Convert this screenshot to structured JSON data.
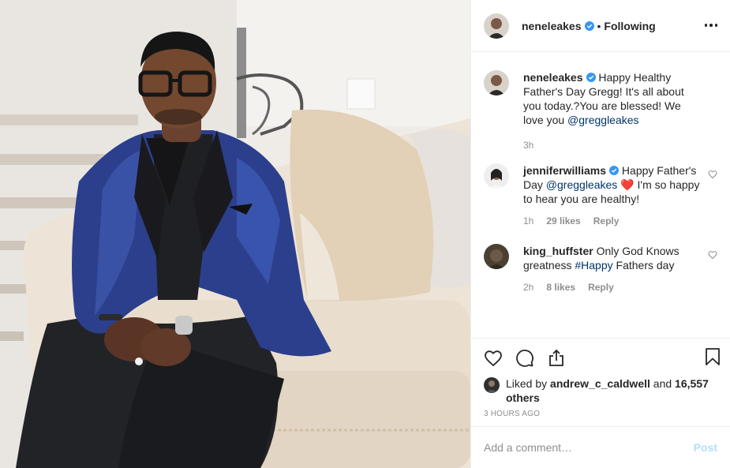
{
  "post": {
    "owner": "neneleakes",
    "dot": "•",
    "follow_status": "Following"
  },
  "caption": {
    "username": "neneleakes",
    "text": " Happy Healthy Father's Day Gregg! It's all about you today.?You are blessed! We love you ",
    "mention": "@greggleakes",
    "time": "3h"
  },
  "comments": [
    {
      "username": "jenniferwilliams",
      "text_before": " Happy Father's Day ",
      "mention": "@greggleakes",
      "emoji": "❤️",
      "text_after": " I'm so happy to hear you are healthy!",
      "time": "1h",
      "likes": "29 likes",
      "reply": "Reply"
    },
    {
      "username": "king_huffster",
      "text_before": " Only God Knows greatness ",
      "hashtag": "#Happy",
      "text_after": " Fathers day",
      "time": "2h",
      "likes": "8 likes",
      "reply": "Reply"
    }
  ],
  "likes": {
    "prefix": "Liked by ",
    "user": "andrew_c_caldwell",
    "mid": " and ",
    "count": "16,557 others"
  },
  "timestamp": "3 HOURS AGO",
  "comment_box": {
    "placeholder": "Add a comment…",
    "post_label": "Post"
  },
  "icons": {
    "verified": "verified-badge-icon",
    "more": "more-options-icon",
    "like": "heart-icon",
    "comment": "comment-icon",
    "share": "share-icon",
    "save": "bookmark-icon"
  },
  "colors": {
    "verified_blue": "#3897f0",
    "link": "#003569",
    "muted": "#8e8e8e",
    "post_disabled": "#b2dffc",
    "heart_emoji": "#e0245e"
  }
}
